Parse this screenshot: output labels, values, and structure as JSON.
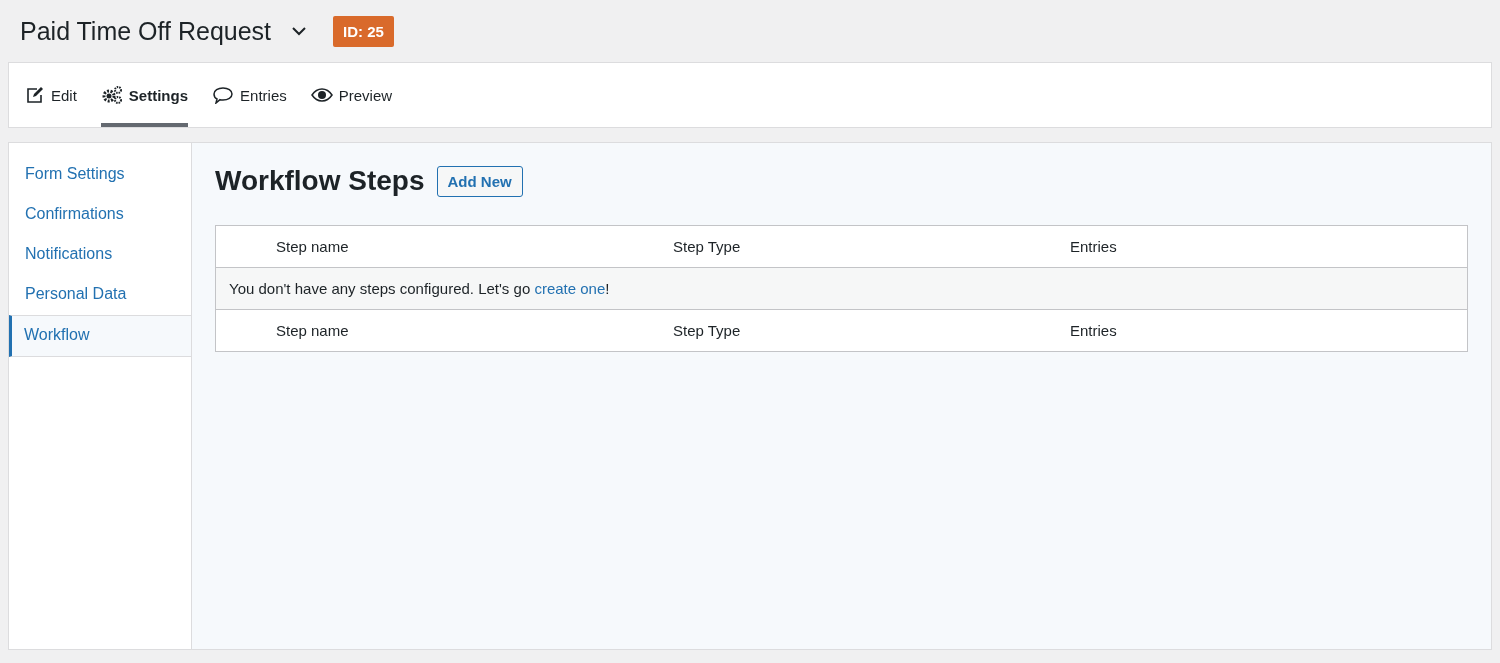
{
  "header": {
    "title": "Paid Time Off Request",
    "id_badge": "ID: 25"
  },
  "tabs": [
    {
      "label": "Edit",
      "kind": "edit",
      "selected": false
    },
    {
      "label": "Settings",
      "kind": "settings",
      "selected": true
    },
    {
      "label": "Entries",
      "kind": "entries",
      "selected": false
    },
    {
      "label": "Preview",
      "kind": "preview",
      "selected": false
    }
  ],
  "sidebar": {
    "items": [
      {
        "label": "Form Settings",
        "selected": false
      },
      {
        "label": "Confirmations",
        "selected": false
      },
      {
        "label": "Notifications",
        "selected": false
      },
      {
        "label": "Personal Data",
        "selected": false
      },
      {
        "label": "Workflow",
        "selected": true
      }
    ]
  },
  "content": {
    "title": "Workflow Steps",
    "add_button": "Add New",
    "table": {
      "columns": [
        "Step name",
        "Step Type",
        "Entries"
      ],
      "empty_message": {
        "text": "You don't have any steps configured. Let's go ",
        "link": "create one",
        "after": "!"
      },
      "footer_columns": [
        "Step name",
        "Step Type",
        "Entries"
      ]
    }
  }
}
